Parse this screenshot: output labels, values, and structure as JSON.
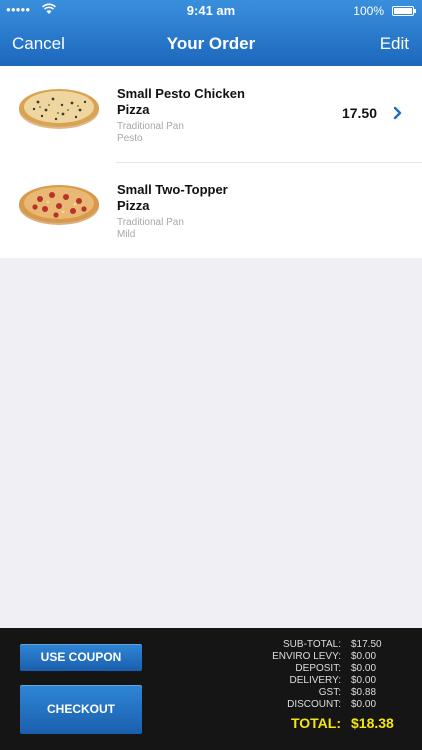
{
  "status_bar": {
    "signal": "●●●●●",
    "time": "9:41 am",
    "battery": "100%"
  },
  "nav": {
    "cancel": "Cancel",
    "title": "Your Order",
    "edit": "Edit"
  },
  "order_items": [
    {
      "name": "Small Pesto Chicken Pizza",
      "crust": "Traditional Pan",
      "option": "Pesto",
      "price": "17.50",
      "icon": "pesto-pizza-icon"
    },
    {
      "name": "Small Two-Topper Pizza",
      "crust": "Traditional Pan",
      "option": "Mild",
      "price": "",
      "icon": "two-topper-pizza-icon"
    }
  ],
  "footer": {
    "use_coupon": "USE COUPON",
    "checkout": "CHECKOUT",
    "totals": [
      {
        "label": "SUB-TOTAL:",
        "value": "$17.50"
      },
      {
        "label": "ENVIRO LEVY:",
        "value": "$0.00"
      },
      {
        "label": "DEPOSIT:",
        "value": "$0.00"
      },
      {
        "label": "DELIVERY:",
        "value": "$0.00"
      },
      {
        "label": "GST:",
        "value": "$0.88"
      },
      {
        "label": "DISCOUNT:",
        "value": "$0.00"
      }
    ],
    "total_label": "TOTAL:",
    "total_value": "$18.38"
  },
  "colors": {
    "nav_blue": "#1c68bd",
    "button_blue": "#2f86d6",
    "total_yellow": "#f4e60f",
    "footer_bg": "#151515",
    "chevron": "#1a6fc0"
  }
}
